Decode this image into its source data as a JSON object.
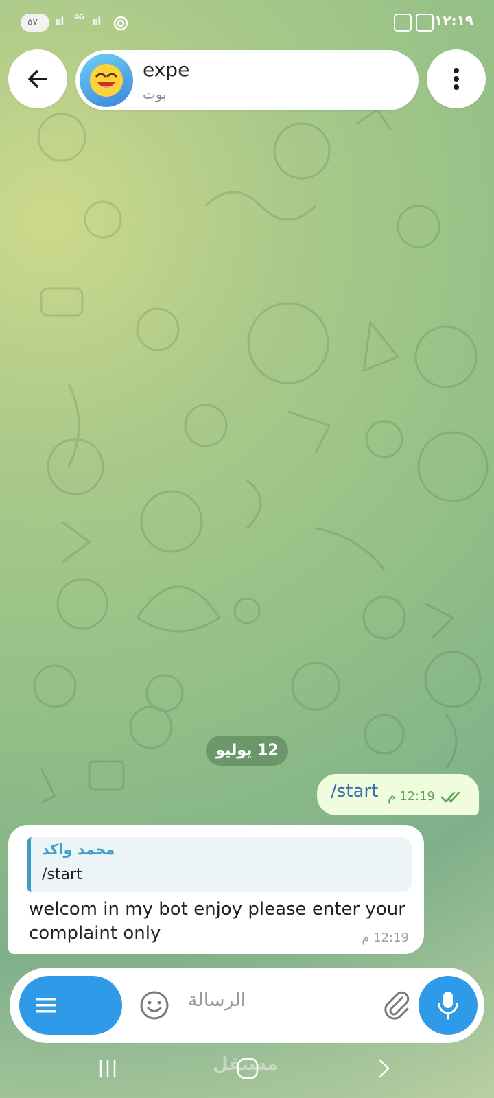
{
  "status_bar": {
    "battery": "٥٧",
    "network": "4G",
    "time": "١٢:١٩"
  },
  "header": {
    "back_icon": "arrow-left-icon",
    "title": "expe",
    "subtitle": "بوت",
    "menu_icon": "more-vertical-icon"
  },
  "chat": {
    "date_chip": "12 يوليو",
    "outgoing": {
      "text": "/start",
      "time": "12:19 م",
      "status": "read"
    },
    "incoming": {
      "reply_name": "محمد واكد",
      "reply_text": "/start",
      "text": "welcom in my bot enjoy please enter your complaint only",
      "time": "12:19 م"
    }
  },
  "input": {
    "placeholder": "الرسالة"
  },
  "navbar": {
    "watermark": "مستقل"
  },
  "colors": {
    "accent": "#2f9ae8",
    "outgoing_bubble": "#effdde",
    "reply_accent": "#3d9ec8"
  }
}
